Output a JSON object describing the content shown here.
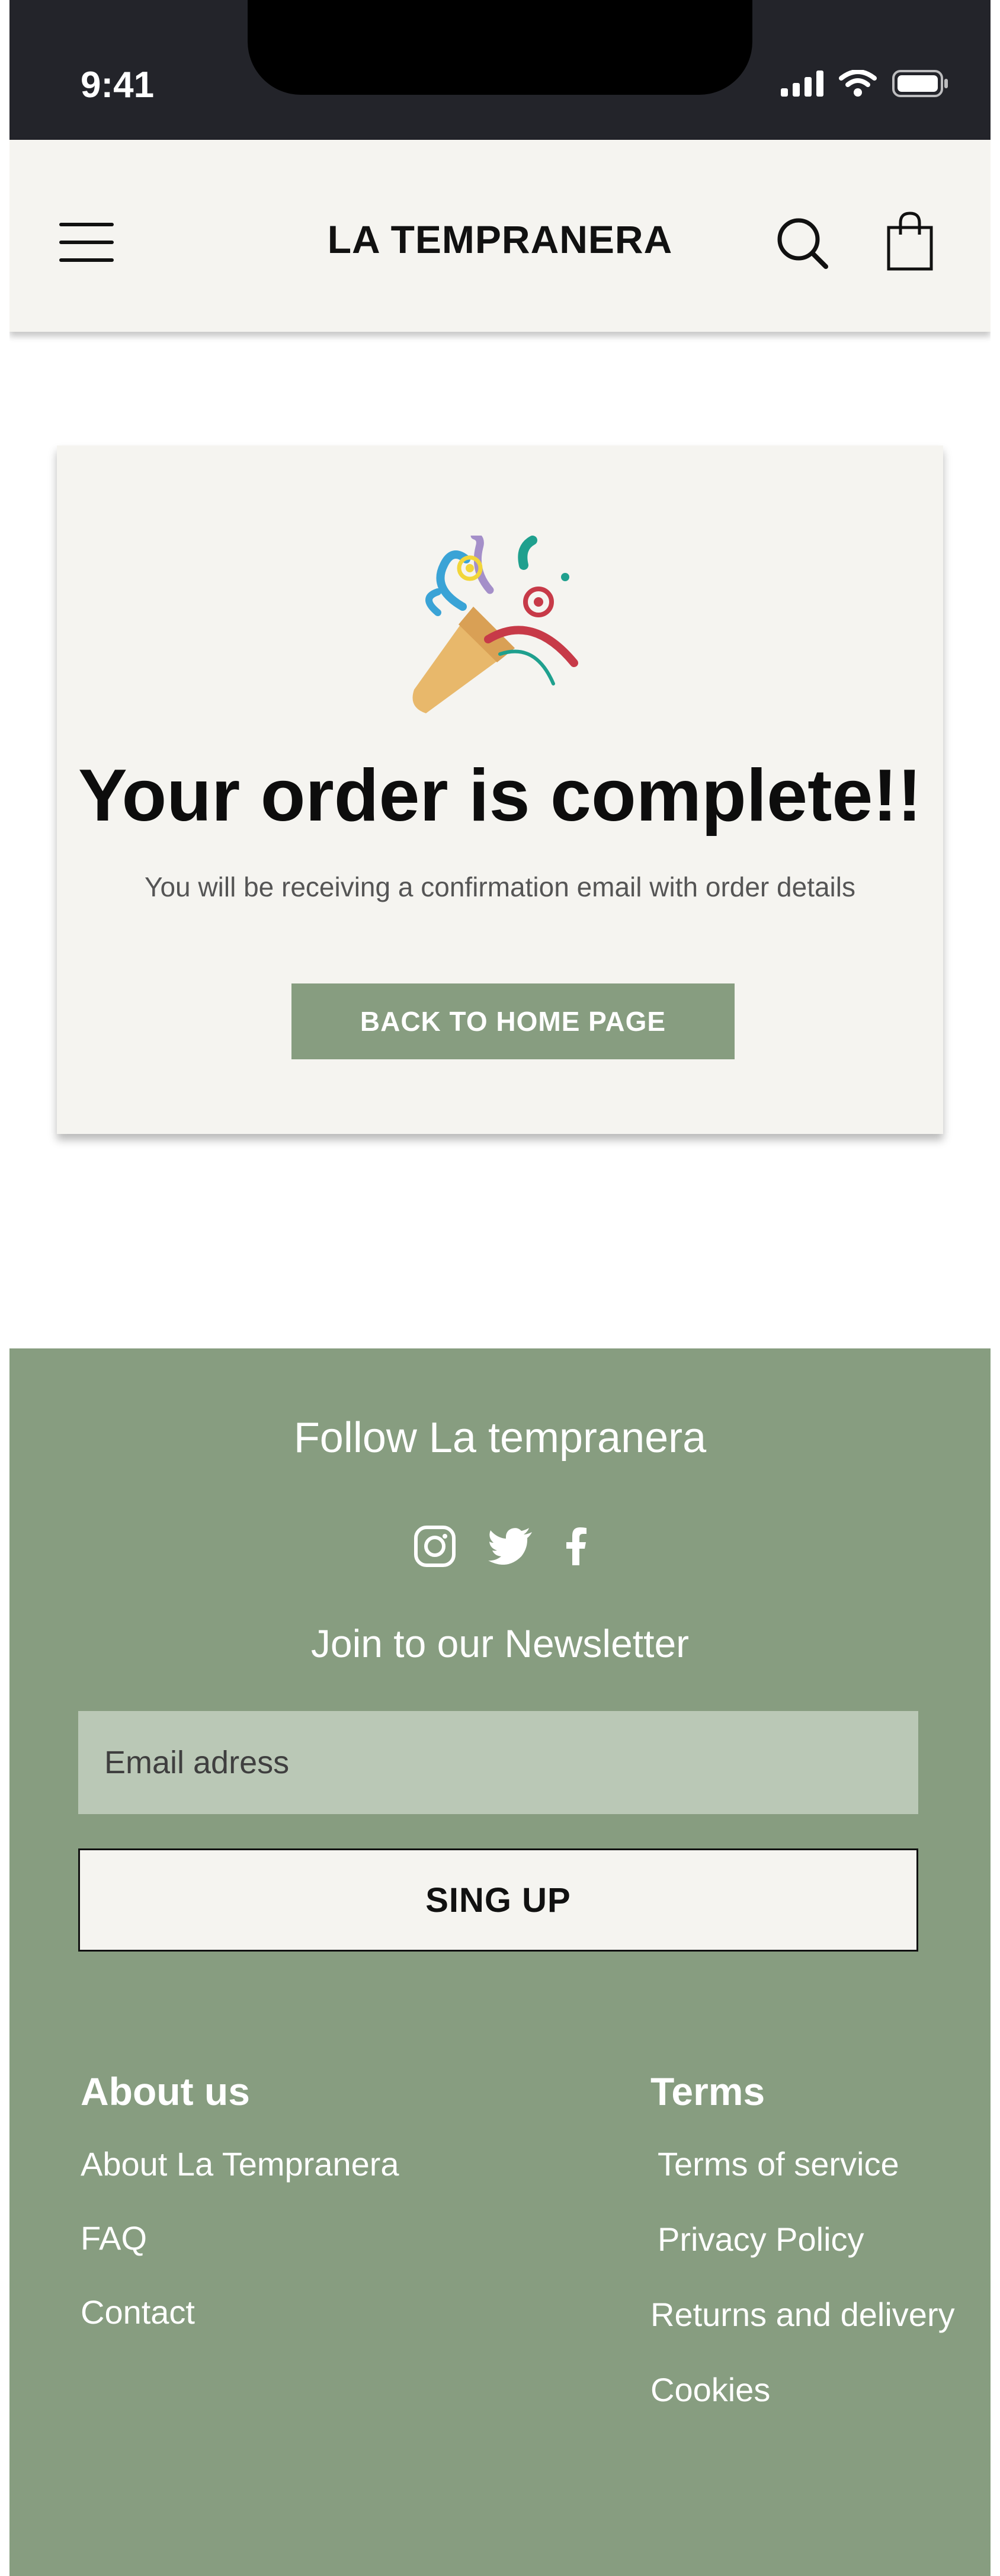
{
  "status_bar": {
    "time": "9:41"
  },
  "header": {
    "brand": "LA TEMPRANERA"
  },
  "confirmation": {
    "title": "Your order is complete!!",
    "subtitle": "You will be receiving a confirmation email with order details",
    "button_label": "BACK TO HOME PAGE"
  },
  "footer": {
    "follow_title": "Follow La tempranera",
    "social": [
      "instagram-icon",
      "twitter-icon",
      "facebook-icon"
    ],
    "newsletter_title": "Join to our Newsletter",
    "email_placeholder": "Email adress",
    "signup_label": "SING UP",
    "about": {
      "heading": "About us",
      "links": [
        "About La Tempranera",
        "FAQ",
        "Contact"
      ]
    },
    "terms": {
      "heading": "Terms",
      "links": [
        "Terms of service",
        "Privacy Policy",
        "Returns and delivery",
        "Cookies"
      ]
    }
  },
  "colors": {
    "status_bar_bg": "#23242a",
    "header_bg": "#f5f4f0",
    "accent_green": "#879d80",
    "input_bg": "#bac8b6"
  }
}
